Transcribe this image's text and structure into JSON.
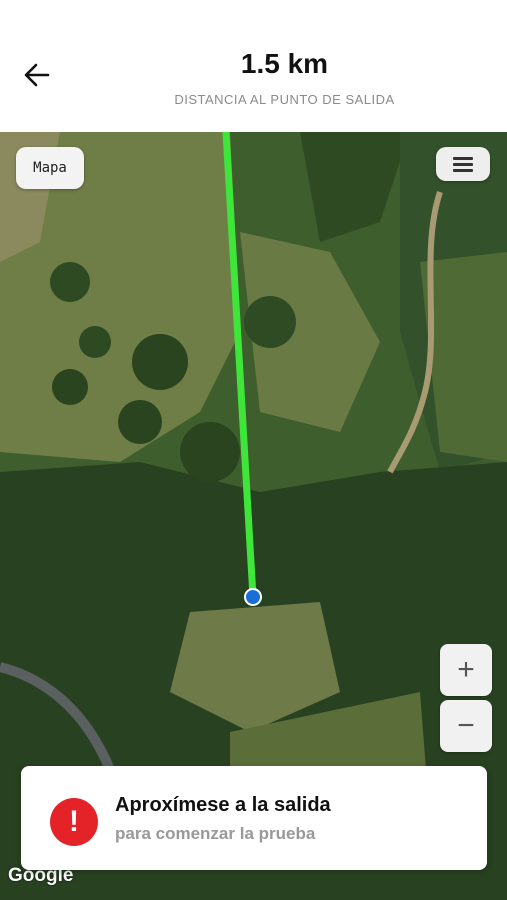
{
  "header": {
    "distance": "1.5 km",
    "subtitle": "DISTANCIA AL PUNTO DE SALIDA"
  },
  "map": {
    "type_button_label": "Mapa",
    "zoom_in_label": "+",
    "zoom_out_label": "−",
    "attribution": "Google",
    "route_color": "#3ee63a",
    "marker_color": "#1a6fd6"
  },
  "alert": {
    "icon_symbol": "!",
    "title": "Aproxímese a la salida",
    "subtitle": "para comenzar la prueba",
    "icon_color": "#e32328"
  }
}
